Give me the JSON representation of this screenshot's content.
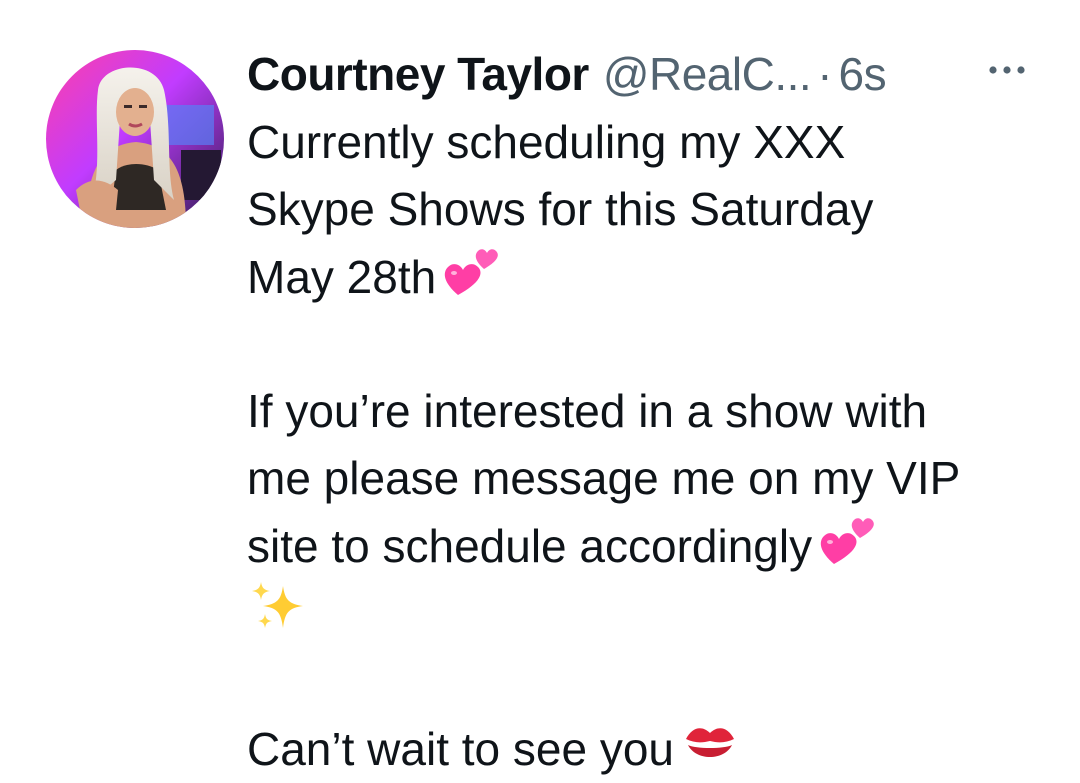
{
  "tweet": {
    "author": {
      "display_name": "Courtney Taylor",
      "handle": "@RealC...",
      "separator": "·",
      "timestamp": "6s"
    },
    "more_icon": "ellipsis-icon",
    "paragraph1": {
      "line1": "Currently scheduling my XXX",
      "line2": "Skype Shows for this Saturday",
      "line3": "May 28th"
    },
    "paragraph2": {
      "line1": "If you’re interested in a show with",
      "line2": "me please message me on my VIP",
      "line3": "site to schedule accordingly"
    },
    "paragraph3": {
      "line1": "Can’t wait to see you"
    },
    "emojis": {
      "hearts": "two-hearts-emoji",
      "sparkles": "sparkles-emoji",
      "kiss": "kiss-mark-emoji"
    },
    "colors": {
      "text": "#0f1419",
      "secondary": "#536471",
      "heart_pink": "#ff3ea5",
      "sparkle_yellow": "#ffcc33",
      "kiss_red": "#e0243a"
    }
  }
}
